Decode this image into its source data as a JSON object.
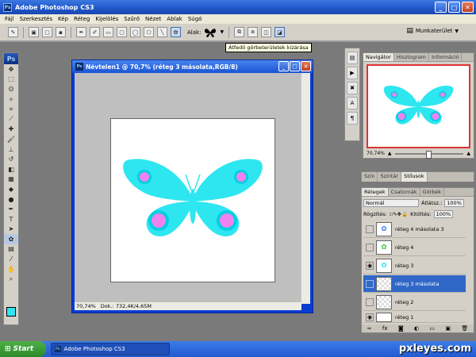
{
  "app": {
    "title": "Adobe Photoshop CS3",
    "logo_text": "Ps"
  },
  "menu": [
    "Fájl",
    "Szerkesztés",
    "Kép",
    "Réteg",
    "Kijelölés",
    "Szűrő",
    "Nézet",
    "Ablak",
    "Súgó"
  ],
  "options": {
    "shape_label": "Alak:",
    "workspace_label": "Munkaterület"
  },
  "tooltip": "Átfedő görbeterületek kizárása",
  "document": {
    "title": "Névtelen1 @ 70,7% (réteg 3 másolata,RGB/8)",
    "zoom": "70,74%",
    "doc_info": "Dok.: 732,4K/4,65M",
    "butterfly": {
      "wing_color": "#2ee6f0",
      "spot_color": "#ee82ee",
      "ring_color": "#00d0e0"
    }
  },
  "navigator": {
    "tabs": [
      "Navigátor",
      "Hisztogram",
      "Információ"
    ],
    "zoom": "70,74%"
  },
  "color_panel": {
    "tabs": [
      "Szín",
      "Színtár",
      "Stílusok"
    ]
  },
  "layers": {
    "tabs": [
      "Rétegek",
      "Csatornák",
      "Görbék"
    ],
    "blend_mode": "Normál",
    "opacity_label": "Átlátsz.:",
    "opacity": "100%",
    "lock_label": "Rögzítés:",
    "fill_label": "Kitöltés:",
    "fill": "100%",
    "items": [
      {
        "name": "réteg 4 másolata 3",
        "visible": false,
        "selected": false,
        "thumb": "blue"
      },
      {
        "name": "réteg 4",
        "visible": false,
        "selected": false,
        "thumb": "green"
      },
      {
        "name": "réteg 3",
        "visible": true,
        "selected": false,
        "thumb": "cyan"
      },
      {
        "name": "réteg 3 másolata",
        "visible": false,
        "selected": true,
        "thumb": "empty"
      },
      {
        "name": "réteg 2",
        "visible": false,
        "selected": false,
        "thumb": "empty"
      },
      {
        "name": "réteg 1",
        "visible": true,
        "selected": false,
        "thumb": "white"
      }
    ]
  },
  "taskbar": {
    "start": "Start",
    "item": "Adobe Photoshop CS3"
  },
  "watermark": "pxleyes.com",
  "colors": {
    "fg_swatch": "#2ee6f0",
    "selection": "#3168c8"
  }
}
